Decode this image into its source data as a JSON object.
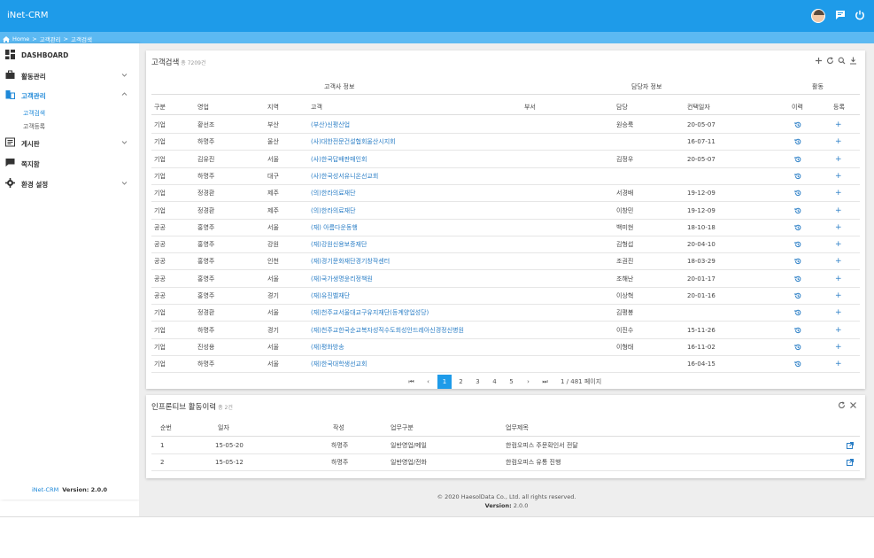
{
  "app": {
    "title": "iNet-CRM"
  },
  "breadcrumb": {
    "home": "Home",
    "sep": ">",
    "level1": "고객관리",
    "level2": "고객검색"
  },
  "sidebar": {
    "items": [
      {
        "label": "DASHBOARD",
        "icon": "dashboard-icon"
      },
      {
        "label": "활동관리",
        "icon": "briefcase-icon"
      },
      {
        "label": "고객관리",
        "icon": "building-icon"
      },
      {
        "label": "게시판",
        "icon": "board-icon"
      },
      {
        "label": "쪽지함",
        "icon": "message-icon"
      },
      {
        "label": "환경 설정",
        "icon": "gear-icon"
      }
    ],
    "submenu": [
      {
        "label": "고객검색"
      },
      {
        "label": "고객등록"
      }
    ],
    "footer": {
      "app": "iNet-CRM",
      "version": "Version: 2.0.0"
    }
  },
  "search": {
    "title": "고객검색",
    "count": "총 7209건",
    "group_headers": {
      "customer": "고객사 정보",
      "manager": "담당자 정보",
      "activity": "활동"
    },
    "columns": [
      "구분",
      "영업",
      "지역",
      "고객",
      "부서",
      "담당",
      "컨택일자",
      "이력",
      "등록"
    ],
    "rows": [
      {
        "type": "기업",
        "sales": "황선조",
        "region": "부산",
        "customer": "(부산)신평산업",
        "dept": "",
        "manager": "원승룩",
        "date": "20-05-07"
      },
      {
        "type": "기업",
        "sales": "하명주",
        "region": "울산",
        "customer": "(사)대한전문건설협회울산시지회",
        "dept": "",
        "manager": "",
        "date": "16-07-11"
      },
      {
        "type": "기업",
        "sales": "김유진",
        "region": "서울",
        "customer": "(사)한국답배판매인회",
        "dept": "",
        "manager": "김정우",
        "date": "20-05-07"
      },
      {
        "type": "기업",
        "sales": "하명주",
        "region": "대구",
        "customer": "(사)한국성서유니온선교회",
        "dept": "",
        "manager": "",
        "date": ""
      },
      {
        "type": "기업",
        "sales": "정경환",
        "region": "제주",
        "customer": "(의)한라의료재단",
        "dept": "",
        "manager": "서경배",
        "date": "19-12-09"
      },
      {
        "type": "기업",
        "sales": "정경환",
        "region": "제주",
        "customer": "(의)한라의료재단",
        "dept": "",
        "manager": "이창민",
        "date": "19-12-09"
      },
      {
        "type": "공공",
        "sales": "홍영주",
        "region": "서울",
        "customer": "(재) 아름다운동행",
        "dept": "",
        "manager": "백미현",
        "date": "18-10-18"
      },
      {
        "type": "공공",
        "sales": "홍영주",
        "region": "강원",
        "customer": "(재)강원신용보증재단",
        "dept": "",
        "manager": "김형섭",
        "date": "20-04-10"
      },
      {
        "type": "공공",
        "sales": "홍영주",
        "region": "인천",
        "customer": "(재)경기문화재단경기창작센터",
        "dept": "",
        "manager": "조권진",
        "date": "18-03-29"
      },
      {
        "type": "공공",
        "sales": "홍영주",
        "region": "서울",
        "customer": "(재)국가생명윤리정책원",
        "dept": "",
        "manager": "조해난",
        "date": "20-01-17"
      },
      {
        "type": "공공",
        "sales": "홍영주",
        "region": "경기",
        "customer": "(재)유진벨재단",
        "dept": "",
        "manager": "이상혁",
        "date": "20-01-16"
      },
      {
        "type": "기업",
        "sales": "정경환",
        "region": "서울",
        "customer": "(재)천주교서울대교구유지재단(등계양업성당)",
        "dept": "",
        "manager": "김평봉",
        "date": ""
      },
      {
        "type": "기업",
        "sales": "하명주",
        "region": "경기",
        "customer": "(재)천주교한국순교복자성직수도회성안드레아신경정신병원",
        "dept": "",
        "manager": "이진수",
        "date": "15-11-26"
      },
      {
        "type": "기업",
        "sales": "진성용",
        "region": "서울",
        "customer": "(재)평화방송",
        "dept": "",
        "manager": "이형태",
        "date": "16-11-02"
      },
      {
        "type": "기업",
        "sales": "하명주",
        "region": "서울",
        "customer": "(재)한국대학생선교회",
        "dept": "",
        "manager": "",
        "date": "16-04-15"
      }
    ],
    "pagination": {
      "pages": [
        "1",
        "2",
        "3",
        "4",
        "5"
      ],
      "current": "1",
      "info": "1 / 481 페이지"
    }
  },
  "history": {
    "title": "인프론티브 활동이력",
    "count": "총 2건",
    "columns": [
      "순번",
      "일자",
      "작성",
      "업무구분",
      "업무제목"
    ],
    "rows": [
      {
        "no": "1",
        "date": "15-05-20",
        "writer": "하명주",
        "category": "일반영업/메일",
        "subject": "한컴오피스 주문확인서 전달"
      },
      {
        "no": "2",
        "date": "15-05-12",
        "writer": "하명주",
        "category": "일반영업/전화",
        "subject": "한컴오피스 유통 진행"
      }
    ]
  },
  "footer": {
    "copyright": "© 2020 HaesolData Co., Ltd. all rights reserved.",
    "version_label": "Version:",
    "version": "2.0.0"
  },
  "colors": {
    "primary": "#1e9be9",
    "breadcrumb_bar": "#5cb9f2",
    "link": "#2a7ec6",
    "background": "#eeeeee"
  }
}
